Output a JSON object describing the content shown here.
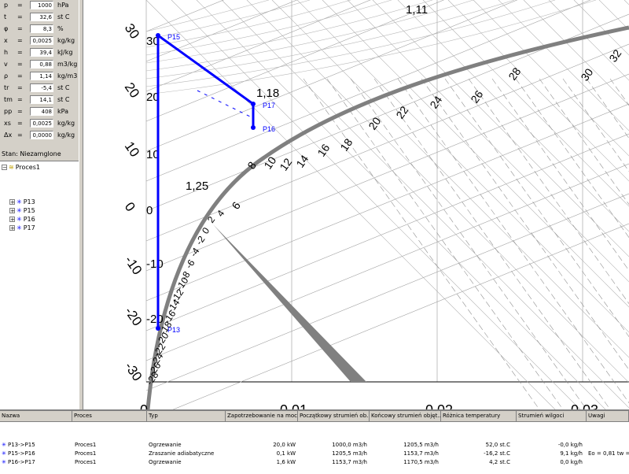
{
  "params": [
    {
      "sym": "p",
      "val": "1000",
      "unit": "hPa"
    },
    {
      "sym": "t",
      "val": "32,6",
      "unit": "st C"
    },
    {
      "sym": "φ",
      "val": "8,3",
      "unit": "%"
    },
    {
      "sym": "x",
      "val": "0,0025",
      "unit": "kg/kg"
    },
    {
      "sym": "h",
      "val": "39,4",
      "unit": "kJ/kg"
    },
    {
      "sym": "v",
      "val": "0,88",
      "unit": "m3/kg"
    },
    {
      "sym": "ρ",
      "val": "1,14",
      "unit": "kg/m3"
    },
    {
      "sym": "tr",
      "val": "-5,4",
      "unit": "st C"
    },
    {
      "sym": "tm",
      "val": "14,1",
      "unit": "st C"
    },
    {
      "sym": "pp",
      "val": "408",
      "unit": "kPa"
    },
    {
      "sym": "xs",
      "val": "0,0025",
      "unit": "kg/kg"
    },
    {
      "sym": "Δx",
      "val": "0,0000",
      "unit": "kg/kg"
    }
  ],
  "stan": "Stan: Niezamglone",
  "tree": {
    "root": "Proces1",
    "items": [
      "P13",
      "P15",
      "P16",
      "P17"
    ]
  },
  "chart": {
    "y_ticks": [
      "30",
      "20",
      "10",
      "0",
      "-10",
      "-20",
      "-30"
    ],
    "y_inner_ticks": [
      "30",
      "20",
      "10",
      "0",
      "-10",
      "-20"
    ],
    "x_ticks": [
      "0",
      "0,01",
      "0,02",
      "0,03"
    ],
    "density_labels": [
      "1,11",
      "1,18",
      "1,25"
    ],
    "enthalpy_labels": [
      "32",
      "30",
      "28",
      "26",
      "24",
      "22",
      "20",
      "18",
      "16",
      "14",
      "12",
      "10",
      "8",
      "6",
      "4",
      "2",
      "0",
      "-2",
      "-4",
      "-6",
      "-8",
      "-10",
      "-12",
      "-14",
      "-16",
      "-18",
      "-20",
      "-22",
      "-24",
      "-26",
      "-28"
    ],
    "points": [
      {
        "name": "P15",
        "t": 30
      },
      {
        "name": "P17",
        "t": 18
      },
      {
        "name": "P16",
        "t": 12
      },
      {
        "name": "P13",
        "t": -22
      }
    ],
    "line_color": "#0000ff",
    "saturation_color": "#808080"
  },
  "table": {
    "headers": [
      "Nazwa",
      "Proces",
      "Typ",
      "Zapotrzebowanie na moc",
      "Początkowy strumień ob...",
      "Końcowy strumień objęt...",
      "Różnica temperatury",
      "Strumień wilgoci",
      "Uwagi"
    ],
    "rows": [
      {
        "name": "P13->P15",
        "proc": "Proces1",
        "typ": "Ogrzewanie",
        "moc": "20,0 kW",
        "pocz": "1000,0 m3/h",
        "konc": "1205,5 m3/h",
        "dt": "52,0 st.C",
        "wilg": "-0,0 kg/h",
        "uwagi": ""
      },
      {
        "name": "P15->P16",
        "proc": "Proces1",
        "typ": "Zraszanie adiabatyczne",
        "moc": "0,1 kW",
        "pocz": "1205,5 m3/h",
        "konc": "1153,7 m3/h",
        "dt": "-16,2 st.C",
        "wilg": "9,1 kg/h",
        "uwagi": "Eo = 0,81 tw ="
      },
      {
        "name": "P16->P17",
        "proc": "Proces1",
        "typ": "Ogrzewanie",
        "moc": "1,6 kW",
        "pocz": "1153,7 m3/h",
        "konc": "1170,5 m3/h",
        "dt": "4,2 st.C",
        "wilg": "0,0 kg/h",
        "uwagi": ""
      }
    ]
  }
}
